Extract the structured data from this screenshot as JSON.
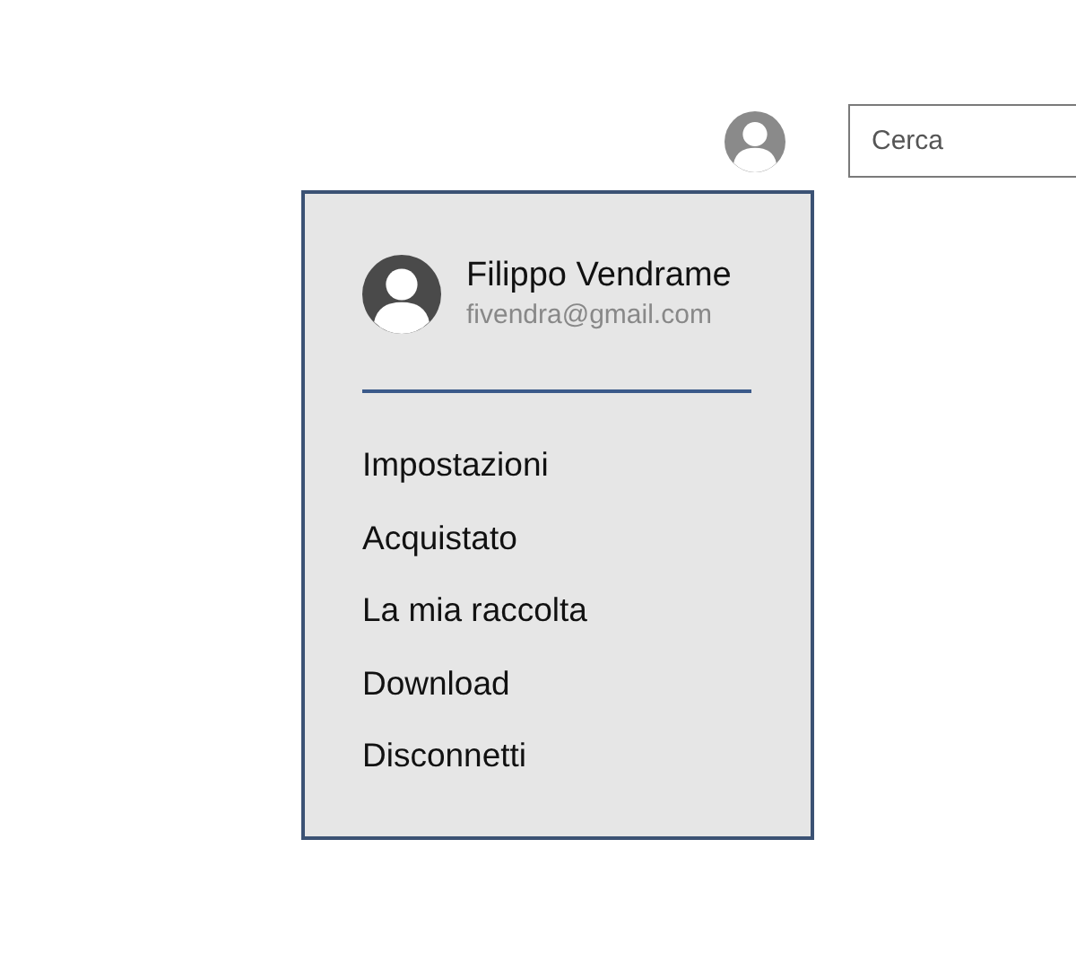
{
  "top_bar": {
    "search": {
      "placeholder": "Cerca"
    }
  },
  "account_menu": {
    "name": "Filippo Vendrame",
    "email": "fivendra@gmail.com",
    "items": [
      "Impostazioni",
      "Acquistato",
      "La mia raccolta",
      "Download",
      "Disconnetti"
    ]
  }
}
